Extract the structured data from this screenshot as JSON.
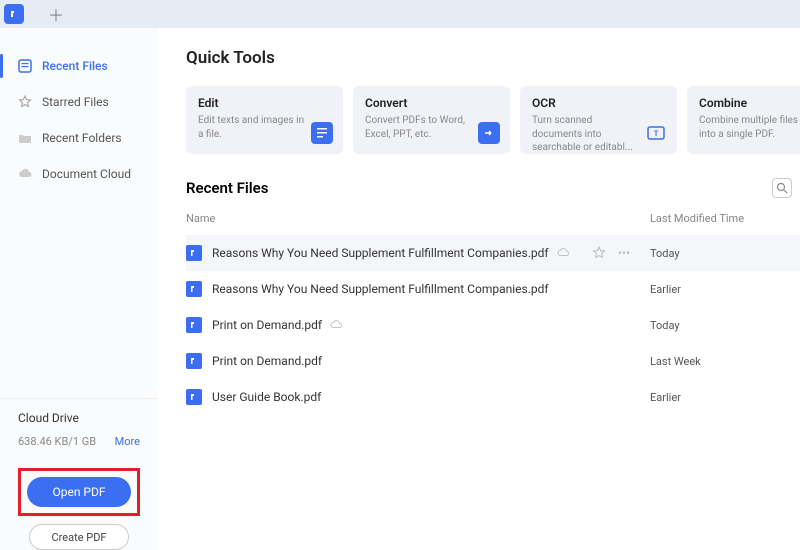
{
  "sidebar": {
    "items": [
      {
        "label": "Recent Files",
        "active": true
      },
      {
        "label": "Starred Files"
      },
      {
        "label": "Recent Folders"
      },
      {
        "label": "Document Cloud"
      }
    ],
    "cloud": {
      "title": "Cloud Drive",
      "usage": "638.46 KB/1 GB",
      "more": "More"
    },
    "open_label": "Open PDF",
    "create_label": "Create PDF"
  },
  "quick_tools": {
    "heading": "Quick Tools",
    "items": [
      {
        "title": "Edit",
        "desc": "Edit texts and images in a file."
      },
      {
        "title": "Convert",
        "desc": "Convert PDFs to Word, Excel, PPT, etc."
      },
      {
        "title": "OCR",
        "desc": "Turn scanned documents into searchable or editabl..."
      },
      {
        "title": "Combine",
        "desc": "Combine multiple files into a single PDF."
      }
    ]
  },
  "recent": {
    "heading": "Recent Files",
    "columns": {
      "name": "Name",
      "time": "Last Modified Time"
    },
    "rows": [
      {
        "name": "Reasons Why You Need Supplement Fulfillment Companies.pdf",
        "time": "Today",
        "cloud": true,
        "hover": true
      },
      {
        "name": "Reasons Why You Need Supplement Fulfillment Companies.pdf",
        "time": "Earlier"
      },
      {
        "name": "Print on Demand.pdf",
        "time": "Today",
        "cloud": true
      },
      {
        "name": "Print on Demand.pdf",
        "time": "Last Week"
      },
      {
        "name": "User Guide Book.pdf",
        "time": "Earlier"
      }
    ]
  }
}
